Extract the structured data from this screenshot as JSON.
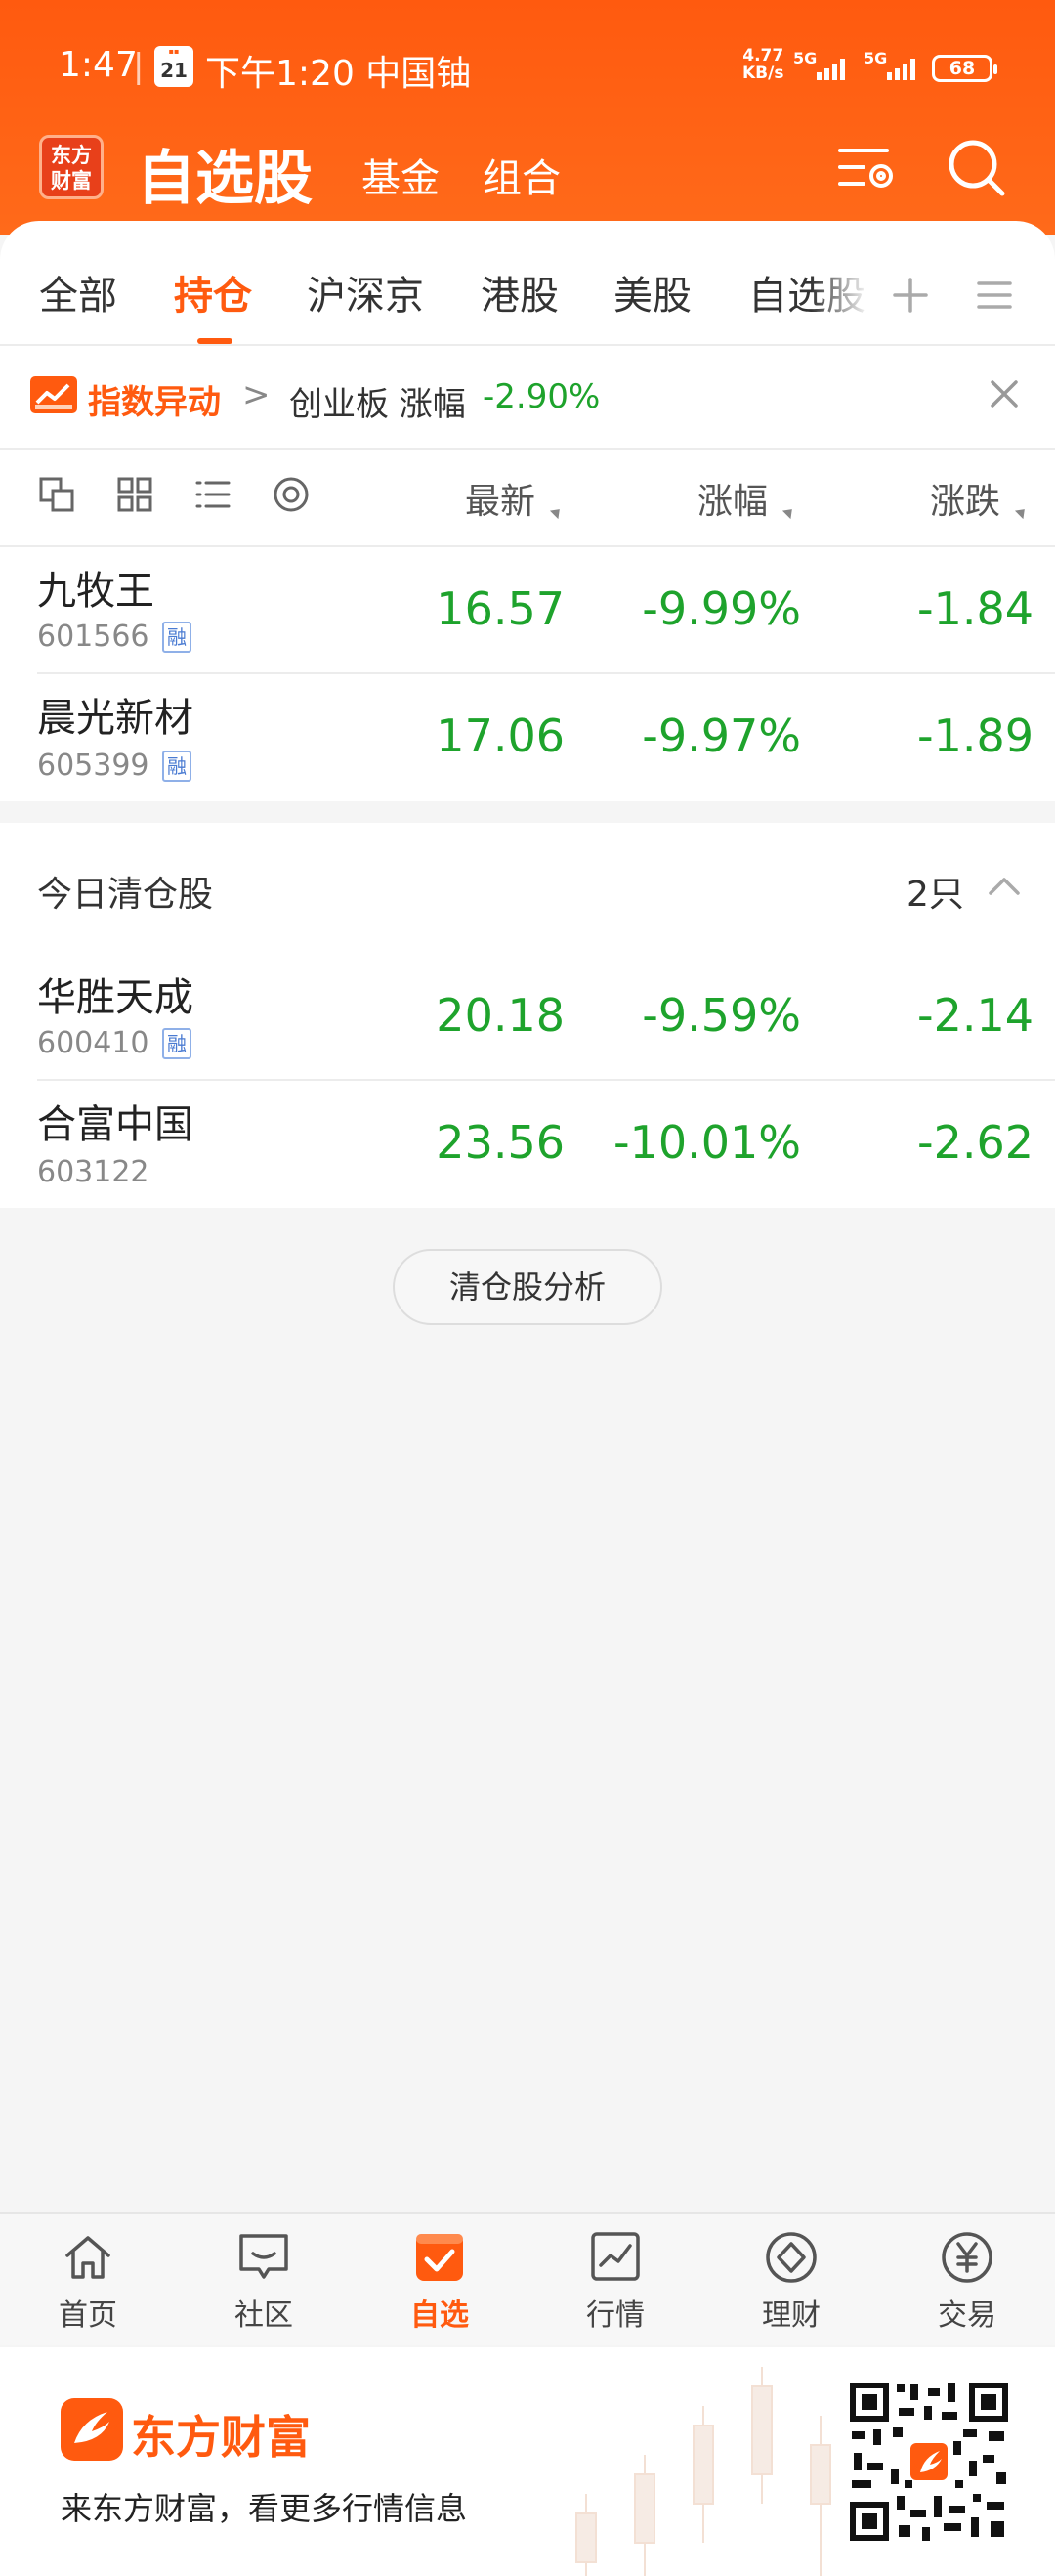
{
  "status_bar": {
    "time": "1:47",
    "separator": "|",
    "calendar_day": "21",
    "notification": "下午1:20 中国铀",
    "net_speed": "4.77",
    "net_unit": "KB/s",
    "sim1": "5G",
    "sim2": "5G",
    "battery": "68"
  },
  "header": {
    "logo_text": "东方\n财富",
    "title": "自选股",
    "links": [
      "基金",
      "组合"
    ],
    "settings_icon": "list-settings-icon",
    "search_icon": "search-icon"
  },
  "tabs": {
    "items": [
      "全部",
      "持仓",
      "沪深京",
      "港股",
      "美股",
      "自选股"
    ],
    "active_index": 1,
    "add_icon": "plus-icon",
    "menu_icon": "menu-icon"
  },
  "alert": {
    "title": "指数异动",
    "chevron": ">",
    "text": "创业板 涨幅",
    "value": "-2.90%"
  },
  "columns": {
    "latest": "最新",
    "change_pct": "涨幅",
    "change": "涨跌"
  },
  "holdings": [
    {
      "name": "九牧王",
      "code": "601566",
      "margin": "融",
      "price": "16.57",
      "pct": "-9.99%",
      "change": "-1.84"
    },
    {
      "name": "晨光新材",
      "code": "605399",
      "margin": "融",
      "price": "17.06",
      "pct": "-9.97%",
      "change": "-1.89"
    }
  ],
  "cleared": {
    "title": "今日清仓股",
    "count": "2只",
    "rows": [
      {
        "name": "华胜天成",
        "code": "600410",
        "margin": "融",
        "price": "20.18",
        "pct": "-9.59%",
        "change": "-2.14"
      },
      {
        "name": "合富中国",
        "code": "603122",
        "margin": "",
        "price": "23.56",
        "pct": "-10.01%",
        "change": "-2.62"
      }
    ],
    "analysis_button": "清仓股分析"
  },
  "bottom_nav": {
    "items": [
      {
        "label": "首页",
        "icon": "home-icon"
      },
      {
        "label": "社区",
        "icon": "chat-icon"
      },
      {
        "label": "自选",
        "icon": "watchlist-icon"
      },
      {
        "label": "行情",
        "icon": "chart-icon"
      },
      {
        "label": "理财",
        "icon": "diamond-icon"
      },
      {
        "label": "交易",
        "icon": "yen-icon"
      }
    ],
    "active_index": 2
  },
  "promo": {
    "brand": "东方财富",
    "tagline": "来东方财富，看更多行情信息"
  },
  "colors": {
    "brand": "#ff5a0f",
    "down_green": "#1ea32c",
    "background": "#f5f5f5"
  }
}
